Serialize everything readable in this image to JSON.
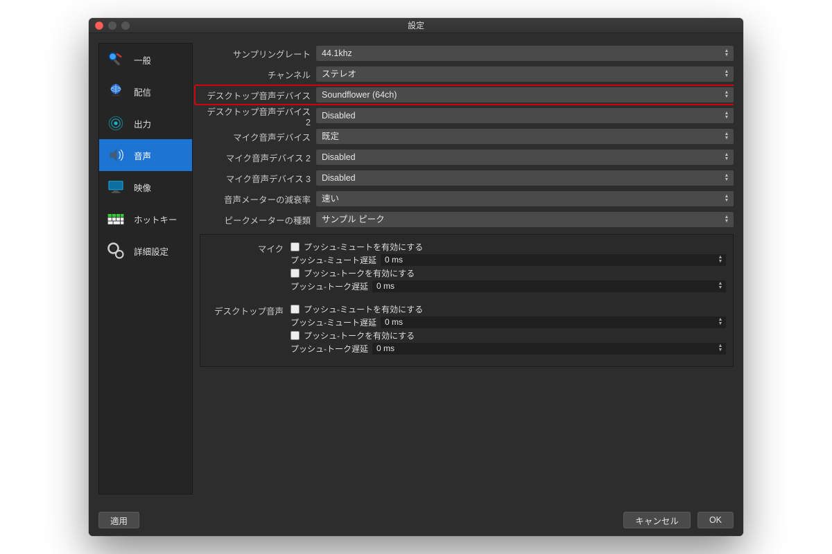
{
  "window": {
    "title": "設定"
  },
  "sidebar": {
    "items": [
      {
        "label": "一般"
      },
      {
        "label": "配信"
      },
      {
        "label": "出力"
      },
      {
        "label": "音声"
      },
      {
        "label": "映像"
      },
      {
        "label": "ホットキー"
      },
      {
        "label": "詳細設定"
      }
    ],
    "active_index": 3
  },
  "audio": {
    "fields": [
      {
        "label": "サンプリングレート",
        "value": "44.1khz"
      },
      {
        "label": "チャンネル",
        "value": "ステレオ"
      },
      {
        "label": "デスクトップ音声デバイス",
        "value": "Soundflower (64ch)",
        "highlight": true
      },
      {
        "label": "デスクトップ音声デバイス 2",
        "value": "Disabled"
      },
      {
        "label": "マイク音声デバイス",
        "value": "既定"
      },
      {
        "label": "マイク音声デバイス 2",
        "value": "Disabled"
      },
      {
        "label": "マイク音声デバイス 3",
        "value": "Disabled"
      },
      {
        "label": "音声メーターの減衰率",
        "value": "速い"
      },
      {
        "label": "ピークメーターの種類",
        "value": "サンプル ピーク"
      }
    ],
    "groups": [
      {
        "title": "マイク",
        "push_mute_enable": "プッシュ-ミュートを有効にする",
        "push_mute_delay_label": "プッシュ-ミュート遅延",
        "push_mute_delay_value": "0 ms",
        "push_talk_enable": "プッシュ-トークを有効にする",
        "push_talk_delay_label": "プッシュ-トーク遅延",
        "push_talk_delay_value": "0 ms"
      },
      {
        "title": "デスクトップ音声",
        "push_mute_enable": "プッシュ-ミュートを有効にする",
        "push_mute_delay_label": "プッシュ-ミュート遅延",
        "push_mute_delay_value": "0 ms",
        "push_talk_enable": "プッシュ-トークを有効にする",
        "push_talk_delay_label": "プッシュ-トーク遅延",
        "push_talk_delay_value": "0 ms"
      }
    ]
  },
  "buttons": {
    "apply": "適用",
    "cancel": "キャンセル",
    "ok": "OK"
  }
}
